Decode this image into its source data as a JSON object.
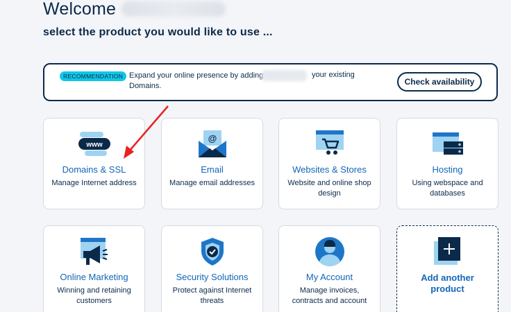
{
  "header": {
    "welcome": "Welcome",
    "subtitle": "select the product you would like to use ..."
  },
  "recommendation": {
    "badge": "RECOMMENDATION",
    "text_part1": "Expand your online presence by adding",
    "text_part2": "your existing",
    "text_line2": "Domains.",
    "button_label": "Check availability"
  },
  "cards": [
    {
      "title": "Domains & SSL",
      "desc": "Manage Internet address",
      "icon": "www-icon"
    },
    {
      "title": "Email",
      "desc": "Manage email addresses",
      "icon": "email-icon"
    },
    {
      "title": "Websites & Stores",
      "desc": "Website and online shop design",
      "icon": "store-icon"
    },
    {
      "title": "Hosting",
      "desc": "Using webspace and databases",
      "icon": "server-icon"
    },
    {
      "title": "Online Marketing",
      "desc": "Winning and retaining customers",
      "icon": "megaphone-icon"
    },
    {
      "title": "Security Solutions",
      "desc": "Protect against Internet threats",
      "icon": "shield-icon"
    },
    {
      "title": "My Account",
      "desc": "Manage invoices, contracts and account",
      "icon": "account-icon"
    },
    {
      "title": "Add another product",
      "desc": "",
      "icon": "plus-icon"
    }
  ],
  "colors": {
    "navy": "#0b2a4a",
    "link_blue": "#1166b8",
    "icon_blue": "#1f76c8",
    "icon_light": "#9fd3f2",
    "badge_cyan": "#11c7e6",
    "arrow_red": "#e8231f"
  }
}
